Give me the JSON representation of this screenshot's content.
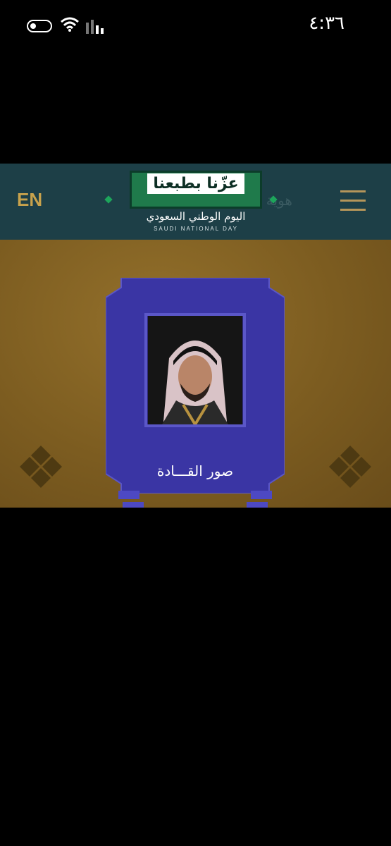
{
  "status_bar": {
    "time": "٤:٣٦"
  },
  "header": {
    "lang_toggle": "EN",
    "ghost_text": "هوية اليوم الوطني · لمكاتب",
    "logo_title": "عزّنا بطبعنا",
    "logo_subtitle": "اليوم الوطني السعودي",
    "logo_tagline": "SAUDI NATIONAL DAY"
  },
  "card": {
    "label": "صور القـــادة"
  },
  "colors": {
    "header_bg": "#1d3f47",
    "gold": "#7c5c20",
    "card_purple": "#3b36a6",
    "accent_green": "#1f7a4b",
    "accent_gold": "#c8a24c"
  }
}
